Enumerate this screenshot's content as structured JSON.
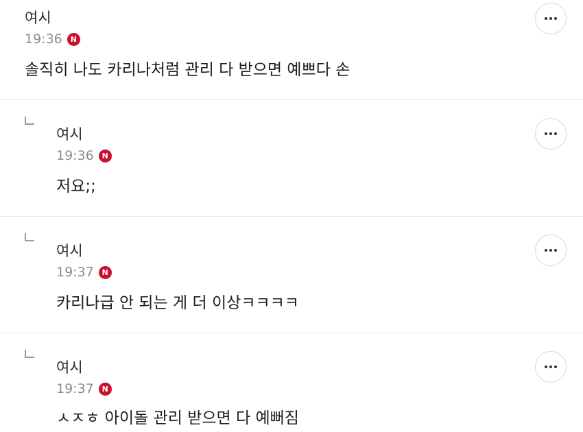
{
  "comments": [
    {
      "author": "여시",
      "time": "19:36",
      "badge": "N",
      "text": "솔직히 나도 카리나처럼 관리 다 받으면 예쁘다 손",
      "is_reply": false
    },
    {
      "author": "여시",
      "time": "19:36",
      "badge": "N",
      "text": "저요;;",
      "is_reply": true
    },
    {
      "author": "여시",
      "time": "19:37",
      "badge": "N",
      "text": "카리나급 안 되는 게 더 이상ㅋㅋㅋㅋ",
      "is_reply": true
    },
    {
      "author": "여시",
      "time": "19:37",
      "badge": "N",
      "text": "ㅅㅈㅎ 아이돌 관리 받으면 다 예뻐짐",
      "is_reply": true
    }
  ],
  "icons": {
    "more": "more-horizontal-icon",
    "reply": "reply-arrow-icon",
    "new_badge": "new-badge-icon"
  },
  "colors": {
    "badge": "#c8102e",
    "time": "#8c8c8c",
    "divider": "#e6e6e6"
  }
}
